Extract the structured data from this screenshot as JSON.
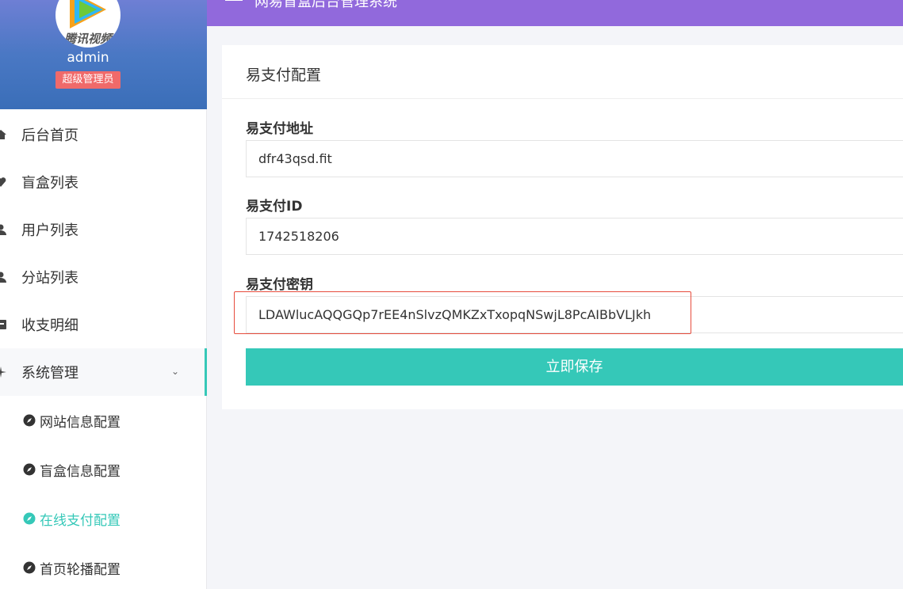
{
  "sidebar": {
    "avatar_text": "腾讯视频",
    "username": "admin",
    "role": "超级管理员",
    "menu": [
      {
        "label": "后台首页",
        "icon": "home-icon"
      },
      {
        "label": "盲盒列表",
        "icon": "heart-icon"
      },
      {
        "label": "用户列表",
        "icon": "user-icon"
      },
      {
        "label": "分站列表",
        "icon": "user-icon"
      },
      {
        "label": "收支明细",
        "icon": "ledger-icon"
      },
      {
        "label": "系统管理",
        "icon": "settings-icon"
      }
    ],
    "submenu": [
      {
        "label": "网站信息配置",
        "icon": "compass-icon"
      },
      {
        "label": "盲盒信息配置",
        "icon": "compass-icon"
      },
      {
        "label": "在线支付配置",
        "icon": "compass-icon"
      },
      {
        "label": "首页轮播配置",
        "icon": "compass-icon"
      }
    ]
  },
  "header": {
    "title": "网易盲盒后台管理系统"
  },
  "card": {
    "title": "易支付配置",
    "fields": [
      {
        "label": "易支付地址",
        "value": "dfr43qsd.fit"
      },
      {
        "label": "易支付ID",
        "value": "1742518206"
      },
      {
        "label": "易支付密钥",
        "value": "LDAWlucAQQGQp7rEE4nSlvzQMKZxTxopqNSwjL8PcAIBbVLJkh"
      }
    ],
    "save_label": "立即保存"
  },
  "colors": {
    "accent": "#35c8b8",
    "header": "#9169dc",
    "badge": "#f06a6a",
    "highlight": "#e74c3c"
  }
}
